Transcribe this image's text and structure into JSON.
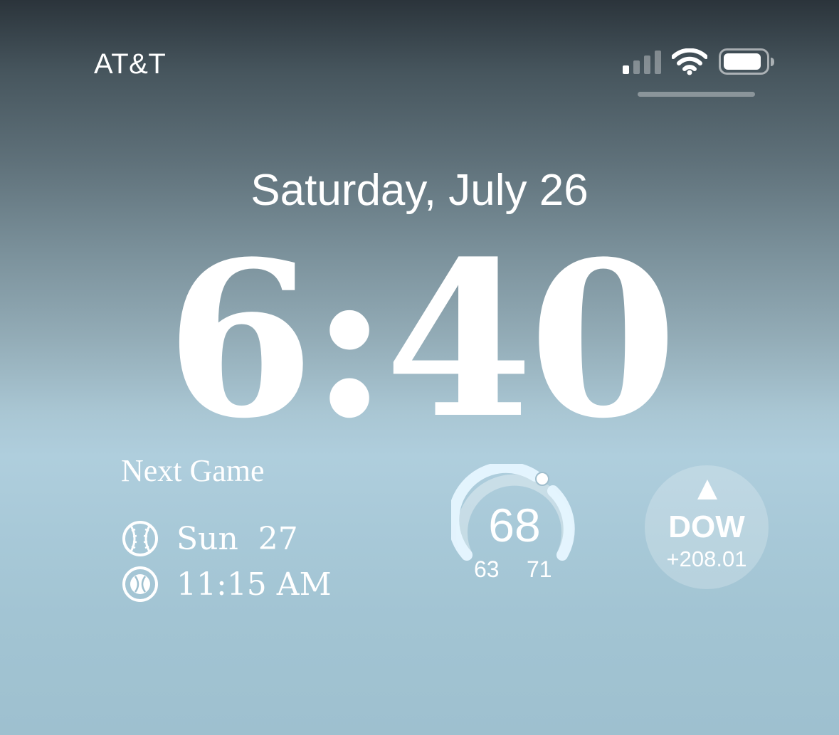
{
  "status_bar": {
    "carrier": "AT&T",
    "signal_icon": "signal-icon",
    "wifi_icon": "wifi-icon",
    "battery_icon": "battery-icon"
  },
  "lock_screen": {
    "date": "Saturday, July 26",
    "time": "6:40"
  },
  "widgets": {
    "next_game": {
      "title": "Next Game",
      "day": "Sun  27",
      "time": "11:15 AM"
    },
    "weather": {
      "temp": "68",
      "low": "63",
      "high": "71"
    },
    "stock": {
      "symbol": "DOW",
      "change": "+208.01",
      "direction": "up"
    }
  }
}
